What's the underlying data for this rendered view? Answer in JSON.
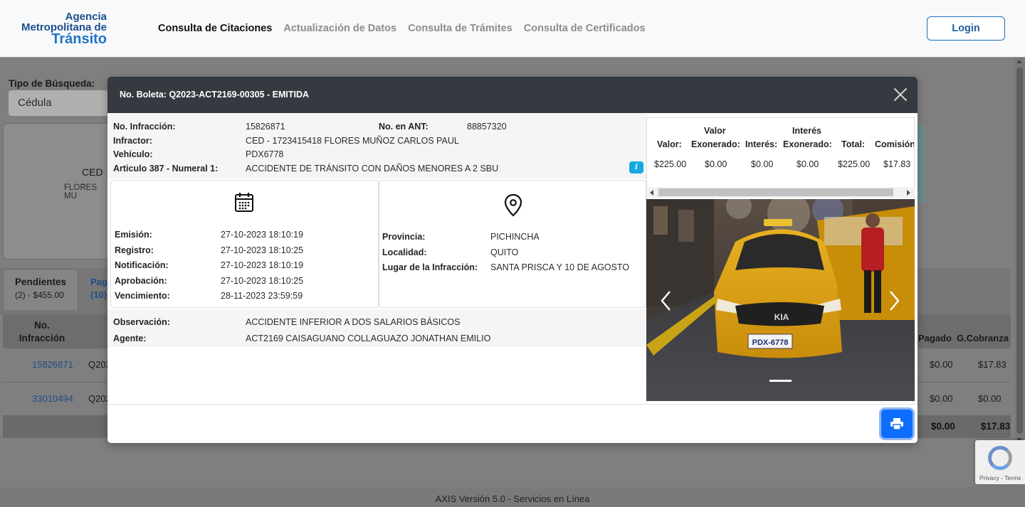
{
  "header": {
    "logo": {
      "line1": "Agencia",
      "line2": "Metropolitana de",
      "line3": "Tránsito"
    },
    "nav": [
      {
        "label": "Consulta de Citaciones",
        "active": true
      },
      {
        "label": "Actualización de Datos",
        "active": false
      },
      {
        "label": "Consulta de Trámites",
        "active": false
      },
      {
        "label": "Consulta de Certificados",
        "active": false
      }
    ],
    "login_label": "Login"
  },
  "background": {
    "search_type_label": "Tipo de Búsqueda:",
    "search_type_value": "Cédula",
    "card_text1": "CED -",
    "card_text2": "FLORES MU",
    "tabs": [
      {
        "label": "Pendientes",
        "sub": "(2) - $455.00"
      },
      {
        "label": "Pag",
        "sub": "(10)"
      }
    ],
    "table": {
      "col_infraccion": "No. Infracción",
      "col_pagado": "Pagado",
      "col_gcobranza": "G.Cobranza",
      "rows": [
        {
          "infraccion": "15826871",
          "boleta": "Q202",
          "pagado": "$0.00",
          "gcobranza": "$17.83"
        },
        {
          "infraccion": "33010494",
          "boleta": "Q202",
          "pagado": "$0.00",
          "gcobranza": "$0.00"
        }
      ],
      "total_pagado": "$0.00",
      "total_gcobranza": "$17.83"
    },
    "footer": "AXIS Versión 5.0 - Servicios en Línea",
    "recaptcha_text": "Privacy - Terms"
  },
  "modal": {
    "title": "No. Boleta: Q2023-ACT2169-00305 - EMITIDA",
    "info": {
      "infraccion_label": "No. Infracción:",
      "infraccion_value": "15826871",
      "ant_label": "No. en ANT:",
      "ant_value": "88857320",
      "infractor_label": "Infractor:",
      "infractor_value": "CED - 1723415418 FLORES MUÑOZ CARLOS PAUL",
      "vehiculo_label": "Vehículo:",
      "vehiculo_value": "PDX6778",
      "articulo_label": "Articulo 387 - Numeral 1:",
      "articulo_value": "ACCIDENTE DE TRÁNSITO CON DAÑOS MENORES A 2 SBU",
      "info_icon": "i"
    },
    "dates": {
      "icon": "calendar-icon",
      "rows": [
        {
          "label": "Emisión:",
          "value": "27-10-2023 18:10:19"
        },
        {
          "label": "Registro:",
          "value": "27-10-2023 18:10:25"
        },
        {
          "label": "Notificación:",
          "value": "27-10-2023 18:10:19"
        },
        {
          "label": "Aprobación:",
          "value": "27-10-2023 18:10:25"
        },
        {
          "label": "Vencimiento:",
          "value": "28-11-2023 23:59:59"
        }
      ]
    },
    "location": {
      "icon": "map-pin-icon",
      "rows": [
        {
          "label": "Provincia:",
          "value": "PICHINCHA"
        },
        {
          "label": "Localidad:",
          "value": "QUITO"
        },
        {
          "label": "Lugar de la Infracción:",
          "value": "SANTA PRISCA Y 10 DE AGOSTO"
        }
      ]
    },
    "extra": {
      "observacion_label": "Observación:",
      "observacion_value": "ACCIDENTE INFERIOR A DOS SALARIOS BÁSICOS",
      "agente_label": "Agente:",
      "agente_value": "ACT2169 CAISAGUANO COLLAGUAZO JONATHAN EMILIO"
    },
    "finance": {
      "headers": [
        {
          "top": "",
          "bottom": "Valor:"
        },
        {
          "top": "Valor",
          "bottom": "Exonerado:"
        },
        {
          "top": "",
          "bottom": "Interés:"
        },
        {
          "top": "Interés",
          "bottom": "Exonerado:"
        },
        {
          "top": "",
          "bottom": "Total:"
        },
        {
          "top": "",
          "bottom": "Comisión"
        }
      ],
      "values": [
        "$225.00",
        "$0.00",
        "$0.00",
        "$0.00",
        "$225.00",
        "$17.83"
      ]
    },
    "photo": {
      "plate": "PDX-6778",
      "taxi_brand": "KIA"
    },
    "colors": {
      "header_bg": "#343a40",
      "primary": "#0d6efd",
      "info": "#15a9e0"
    }
  }
}
